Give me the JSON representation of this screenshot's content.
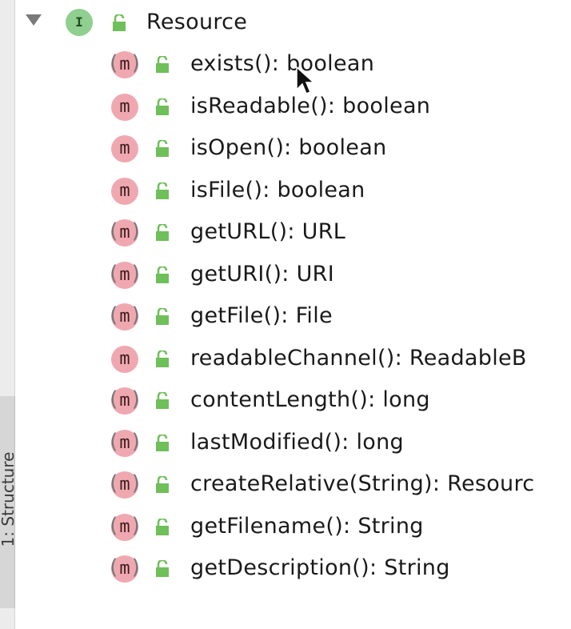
{
  "side_tab": {
    "label": "1: Structure"
  },
  "root": {
    "label": "Resource",
    "badge": "I",
    "icon": "interface-icon"
  },
  "methods": [
    {
      "label": "exists(): boolean",
      "abstract": true
    },
    {
      "label": "isReadable(): boolean",
      "abstract": false
    },
    {
      "label": "isOpen(): boolean",
      "abstract": false
    },
    {
      "label": "isFile(): boolean",
      "abstract": false
    },
    {
      "label": "getURL(): URL",
      "abstract": true
    },
    {
      "label": "getURI(): URI",
      "abstract": true
    },
    {
      "label": "getFile(): File",
      "abstract": true
    },
    {
      "label": "readableChannel(): ReadableB",
      "abstract": false
    },
    {
      "label": "contentLength(): long",
      "abstract": true
    },
    {
      "label": "lastModified(): long",
      "abstract": true
    },
    {
      "label": "createRelative(String): Resourc",
      "abstract": true
    },
    {
      "label": "getFilename(): String",
      "abstract": true
    },
    {
      "label": "getDescription(): String",
      "abstract": true
    }
  ],
  "method_badge": "m",
  "colors": {
    "interface_badge": "#8fcf8f",
    "method_badge": "#f0a8b0",
    "lock": "#6fbf5a"
  }
}
